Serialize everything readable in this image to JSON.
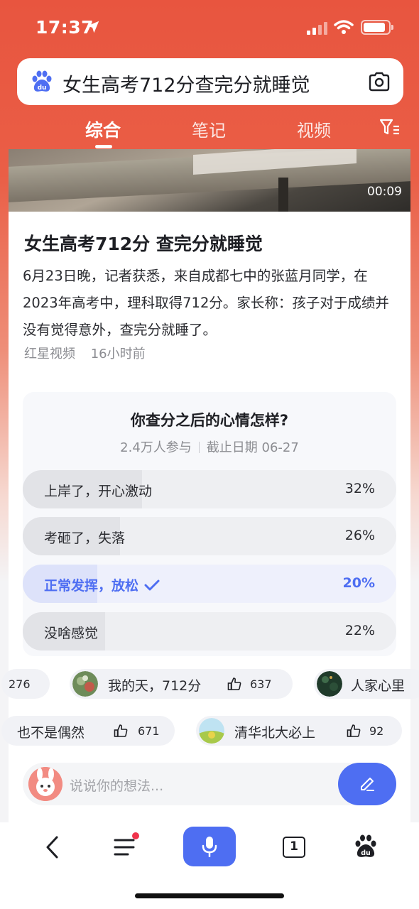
{
  "status_bar": {
    "time": "17:37"
  },
  "search": {
    "query": "女生高考712分查完分就睡觉",
    "logo_icon": "baidu-paw-icon",
    "camera_icon": "camera-icon"
  },
  "tabs": [
    {
      "label": "综合",
      "active": true
    },
    {
      "label": "笔记",
      "active": false
    },
    {
      "label": "视频",
      "active": false
    }
  ],
  "article": {
    "video_duration": "00:09",
    "title": "女生高考712分 查完分就睡觉",
    "summary": "6月23日晚，记者获悉，来自成都七中的张蓝月同学，在2023年高考中，理科取得712分。家长称：孩子对于成绩并没有觉得意外，查完分就睡了。",
    "source": "红星视频",
    "time_ago": "16小时前"
  },
  "poll": {
    "question": "你查分之后的心情怎样?",
    "participants": "2.4万人参与",
    "deadline": "截止日期 06-27",
    "options": [
      {
        "label": "上岸了，开心激动",
        "percent_text": "32%",
        "percent": 32,
        "selected": false
      },
      {
        "label": "考砸了，失落",
        "percent_text": "26%",
        "percent": 26,
        "selected": false
      },
      {
        "label": "正常发挥，放松",
        "percent_text": "20%",
        "percent": 20,
        "selected": true
      },
      {
        "label": "没啥感觉",
        "percent_text": "22%",
        "percent": 22,
        "selected": false
      }
    ]
  },
  "comments_row1": [
    {
      "text": "",
      "likes": "276"
    },
    {
      "text": "我的天，712分",
      "likes": "637"
    },
    {
      "text": "人家心里",
      "likes": ""
    }
  ],
  "comments_row2": [
    {
      "text": "也不是偶然",
      "likes": "671"
    },
    {
      "text": "清华北大必上",
      "likes": "92"
    }
  ],
  "comment_input": {
    "placeholder": "说说你的想法..."
  },
  "bottom_nav": {
    "tab_count": "1"
  },
  "colors": {
    "brand_red": "#e8553f",
    "accent_blue": "#4e6ef2",
    "badge_red": "#f0334b"
  }
}
